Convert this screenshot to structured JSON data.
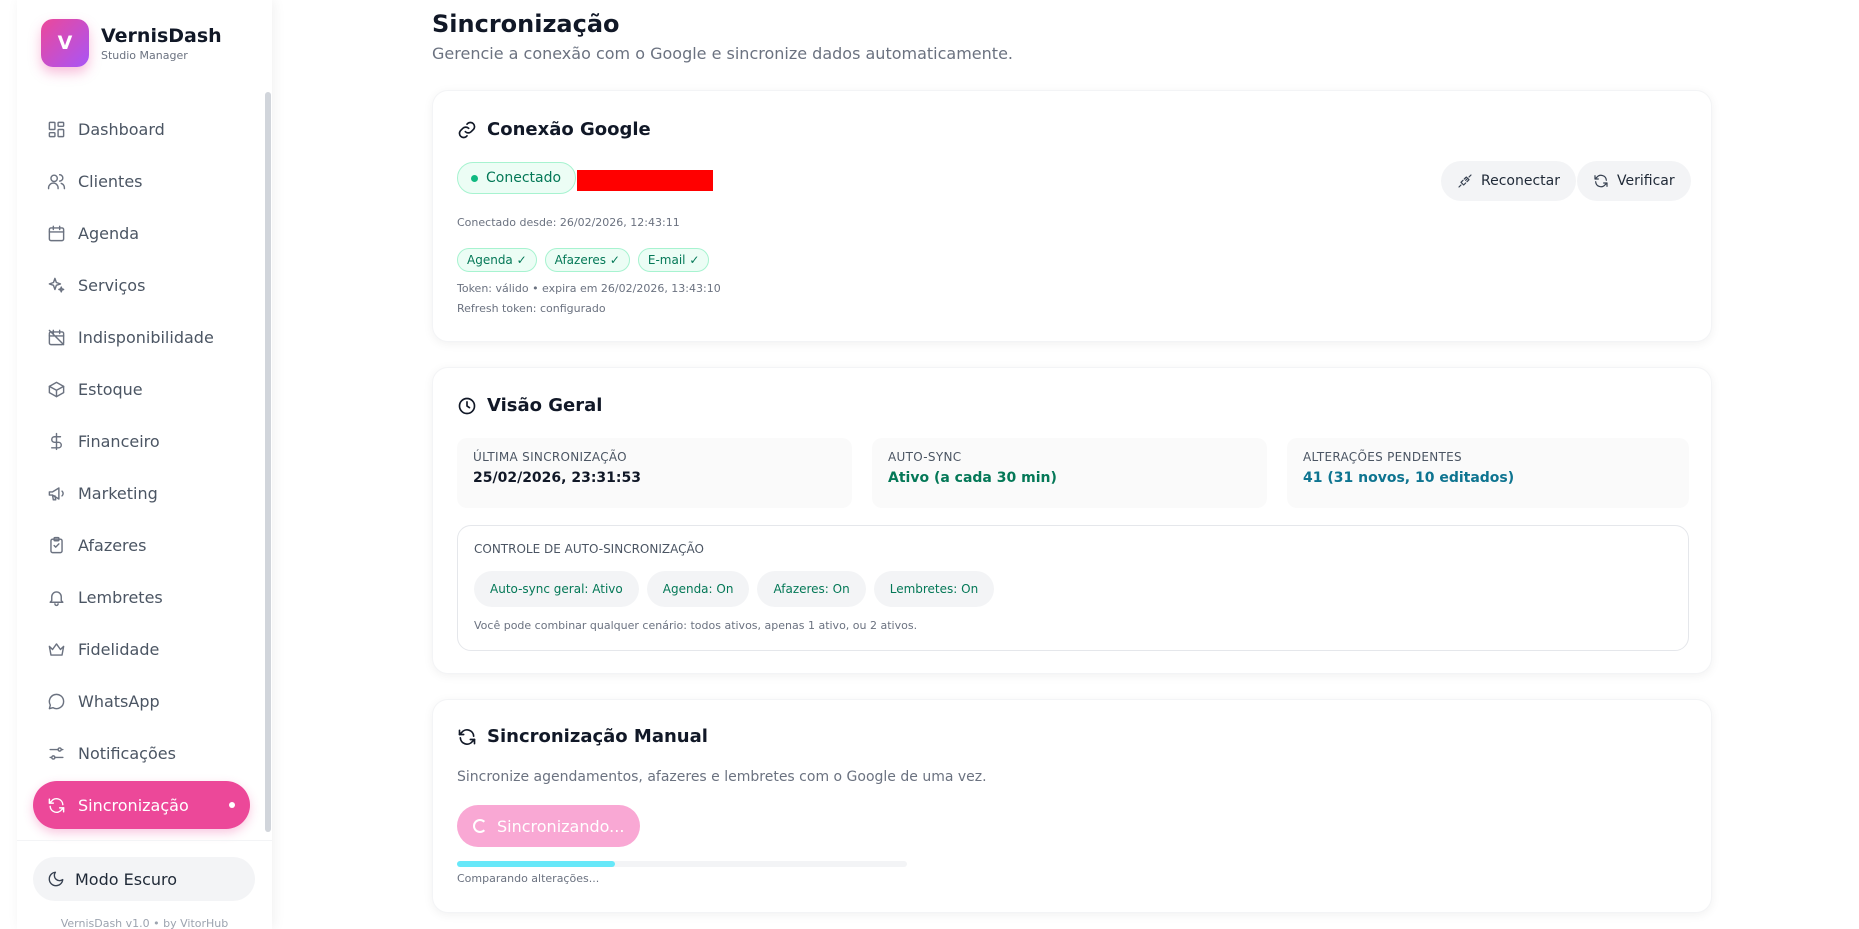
{
  "brand": {
    "logo_letter": "V",
    "name": "VernisDash",
    "subtitle": "Studio Manager"
  },
  "sidebar": {
    "items": [
      {
        "label": "Dashboard",
        "icon": "grid-icon"
      },
      {
        "label": "Clientes",
        "icon": "users-icon"
      },
      {
        "label": "Agenda",
        "icon": "calendar-icon"
      },
      {
        "label": "Serviços",
        "icon": "sparkles-icon"
      },
      {
        "label": "Indisponibilidade",
        "icon": "calendar-off-icon"
      },
      {
        "label": "Estoque",
        "icon": "box-icon"
      },
      {
        "label": "Financeiro",
        "icon": "dollar-icon"
      },
      {
        "label": "Marketing",
        "icon": "megaphone-icon"
      },
      {
        "label": "Afazeres",
        "icon": "clipboard-icon"
      },
      {
        "label": "Lembretes",
        "icon": "bell-icon"
      },
      {
        "label": "Fidelidade",
        "icon": "crown-icon"
      },
      {
        "label": "WhatsApp",
        "icon": "message-circle-icon"
      },
      {
        "label": "Notificações",
        "icon": "sliders-icon"
      },
      {
        "label": "Sincronização",
        "icon": "refresh-icon",
        "active": true
      }
    ],
    "dark_mode_label": "Modo Escuro",
    "footer": "VernisDash v1.0 • by VitorHub"
  },
  "page": {
    "title": "Sincronização",
    "subtitle": "Gerencie a conexão com o Google e sincronize dados automaticamente."
  },
  "connection": {
    "title": "Conexão Google",
    "status": "Conectado",
    "connected_since": "Conectado desde: 26/02/2026, 12:43:11",
    "scopes": [
      "Agenda ✓",
      "Afazeres ✓",
      "E-mail ✓"
    ],
    "token": "Token: válido • expira em 26/02/2026, 13:43:10",
    "refresh_token": "Refresh token: configurado",
    "reconnect_label": "Reconectar",
    "verify_label": "Verificar"
  },
  "overview": {
    "title": "Visão Geral",
    "stats": [
      {
        "label": "ÚLTIMA SINCRONIZAÇÃO",
        "value": "25/02/2026, 23:31:53",
        "color": "#111827"
      },
      {
        "label": "AUTO-SYNC",
        "value": "Ativo (a cada 30 min)",
        "color": "#047857"
      },
      {
        "label": "ALTERAÇÕES PENDENTES",
        "value": "41 (31 novos, 10 editados)",
        "color": "#0e7490"
      }
    ],
    "control_label": "CONTROLE DE AUTO-SINCRONIZAÇÃO",
    "control_pills": [
      "Auto-sync geral: Ativo",
      "Agenda: On",
      "Afazeres: On",
      "Lembretes: On"
    ],
    "control_note": "Você pode combinar qualquer cenário: todos ativos, apenas 1 ativo, ou 2 ativos."
  },
  "manual": {
    "title": "Sincronização Manual",
    "description": "Sincronize agendamentos, afazeres e lembretes com o Google de uma vez.",
    "button_label": "Sincronizando...",
    "progress": 0.35,
    "progress_label": "Comparando alterações..."
  },
  "colors": {
    "accent": "#ec4899",
    "success": "#047857",
    "info": "#0e7490",
    "progress": "#67e8f9"
  }
}
